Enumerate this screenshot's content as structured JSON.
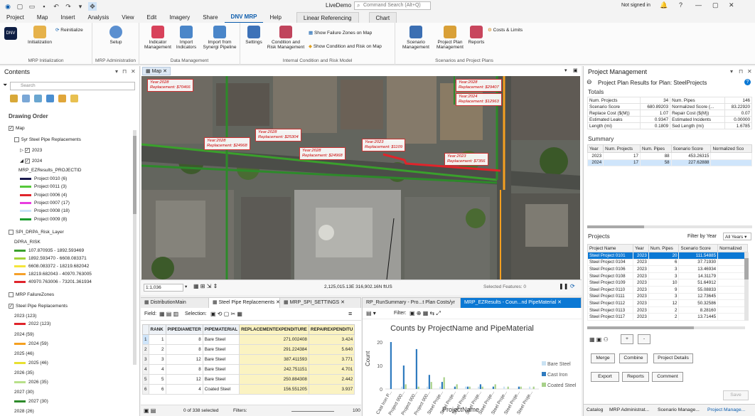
{
  "window": {
    "doc_title": "LiveDemo",
    "search_placeholder": "Command Search (Alt+Q)",
    "signin": "Not signed in"
  },
  "tabs": [
    "Project",
    "Map",
    "Insert",
    "Analysis",
    "View",
    "Edit",
    "Imagery",
    "Share",
    "DNV MRP",
    "Help",
    "Linear Referencing",
    "Chart"
  ],
  "ribbon": {
    "groups": [
      "MRP Initialization",
      "MRP Administration",
      "Data Management",
      "Internal Condition and Risk Model",
      "Scenarios and Project Plans"
    ],
    "buttons": {
      "dnv": "DNV",
      "initialization": "Initialization",
      "reinitialize": "Reinitialize",
      "setup": "Setup",
      "indicator": "Indicator\nManagement",
      "import_ind": "Import\nIndicators",
      "import_syn": "Import from\nSynergi Pipeline",
      "settings": "Settings",
      "condition": "Condition and\nRisk Management",
      "failure_zones": "Show Failure Zones on Map",
      "cond_risk_map": "Show Condition and Risk on Map",
      "scenario": "Scenario\nManagement",
      "projplan": "Project Plan\nManagement",
      "reports": "Reports",
      "costs": "Costs & Limits"
    }
  },
  "contents": {
    "title": "Contents",
    "search_placeholder": "Search",
    "drawing_order": "Drawing Order",
    "items": [
      {
        "text": "Map"
      },
      {
        "text": "5yr Steel Pipe Replacements"
      },
      {
        "text": "2023"
      },
      {
        "text": "2024"
      },
      {
        "text": "MRP_EZResults_PROJECTID"
      },
      {
        "text": "Project 0010 (6)",
        "color": "#1a1a4d"
      },
      {
        "text": "Project 0011 (3)",
        "color": "#56c83a"
      },
      {
        "text": "Project 0006 (4)",
        "color": "#e0242b"
      },
      {
        "text": "Project 0007 (17)",
        "color": "#e83de0"
      },
      {
        "text": "Project 0008 (18)",
        "color": "#c9e3f7"
      },
      {
        "text": "Project 0009 (8)",
        "color": "#1b9c2f"
      },
      {
        "text": "SPI_DRPA_Risk_Layer"
      },
      {
        "text": "DPRA_RISK"
      },
      {
        "text": "107.870935 - 1892.593469",
        "color": "#3aa02c"
      },
      {
        "text": "1892.593470 - 6608.083371",
        "color": "#a4d33a"
      },
      {
        "text": "6608.083372 - 18219.682042",
        "color": "#f5e53a"
      },
      {
        "text": "18219.682043 - 40970.763005",
        "color": "#f5a02a"
      },
      {
        "text": "40970.763006 - 73201.361934",
        "color": "#e0242b"
      },
      {
        "text": "MRP FailureZones"
      },
      {
        "text": "Steel Pipe Replacements"
      },
      {
        "text": "2023 (123)"
      },
      {
        "text": "2022 (123)",
        "color": "#e0242b"
      },
      {
        "text": "2024 (59)"
      },
      {
        "text": "2024 (59)",
        "color": "#f5a020"
      },
      {
        "text": "2025 (46)"
      },
      {
        "text": "2025 (46)",
        "color": "#e8e030"
      },
      {
        "text": "2026 (35)"
      },
      {
        "text": "2026 (35)",
        "color": "#b8e08a"
      },
      {
        "text": "2027 (30)"
      },
      {
        "text": "2027 (30)",
        "color": "#2d8a2a"
      },
      {
        "text": "2028 (26)"
      }
    ]
  },
  "map": {
    "tab": "Map",
    "scale": "1:1,036",
    "coords": "2,125,015.13E 316,902.16N ftUS",
    "selected": "Selected Features: 0",
    "callouts": [
      {
        "year": "Year:2028",
        "repl": "Replacement: $70466"
      },
      {
        "year": "Year:2028",
        "repl": "Replacement: $29407"
      },
      {
        "year": "Year:2024",
        "repl": "Replacement: $12963"
      },
      {
        "year": "Year:2028",
        "repl": "Replacement: $25304"
      },
      {
        "year": "Year:2028",
        "repl": "Replacement: $24968"
      },
      {
        "year": "Year:2028",
        "repl": "Replacement: $24968"
      },
      {
        "year": "Year:2023",
        "repl": "Replacement: $1109"
      },
      {
        "year": "Year:2023",
        "repl": "Replacement: $7356"
      }
    ]
  },
  "table": {
    "tabs": [
      "DistributionMain",
      "Steel Pipe Replacements",
      "MRP_SPI_SETTINGS"
    ],
    "field_label": "Field:",
    "selection_label": "Selection:",
    "columns": [
      "",
      "RANK",
      "PIPEDIAMETER",
      "PIPEMATERIAL",
      "REPLACEMENTEXPENDITURE",
      "REPAIREXPENDITU"
    ],
    "rows": [
      [
        "1",
        "1",
        "8",
        "Bare Steel",
        "271.002408",
        "3.424"
      ],
      [
        "2",
        "2",
        "8",
        "Bare Steel",
        "291.224384",
        "5.640"
      ],
      [
        "3",
        "3",
        "12",
        "Bare Steel",
        "387.411593",
        "3.771"
      ],
      [
        "4",
        "4",
        "8",
        "Bare Steel",
        "242.751151",
        "4.701"
      ],
      [
        "5",
        "5",
        "12",
        "Bare Steel",
        "250.884308",
        "2.442"
      ],
      [
        "6",
        "6",
        "4",
        "Coated Steel",
        "156.551205",
        "3.937"
      ]
    ],
    "footer": "0 of 338 selected",
    "filters": "Filters:",
    "zoom": "100"
  },
  "chart": {
    "tabs": [
      "RP_RunSummary - Pro...t Plan Costs/yr",
      "MRP_EZResults - Coun...nd PipeMaterial"
    ],
    "filter_label": "Filter:",
    "chart_data": {
      "type": "bar",
      "title": "Counts by ProjectName and PipeMaterial",
      "xlabel": "ProjectName",
      "ylabel": "Count",
      "ylim": [
        0,
        20
      ],
      "yticks": [
        "20",
        "10",
        "0"
      ],
      "categories": [
        "Cast Iron P...",
        "Project 000...",
        "Project 000...",
        "Project 000...",
        "Steel Proje...",
        "Steel Proje...",
        "Steel Proje...",
        "Steel Proje...",
        "Steel Proje...",
        "Steel Proje...",
        "Steel Proje...",
        "Steel Proje..."
      ],
      "series": [
        {
          "name": "Bare Steel",
          "color": "#c9e2f3",
          "values": [
            0,
            1,
            0,
            1,
            1,
            0,
            1,
            1,
            0,
            1,
            0,
            1
          ]
        },
        {
          "name": "Cast Iron",
          "color": "#2f7bbf",
          "values": [
            20,
            10,
            17,
            6,
            3,
            1,
            1,
            2,
            1,
            0,
            1,
            0
          ]
        },
        {
          "name": "Coated Steel",
          "color": "#a8d18a",
          "values": [
            0,
            2,
            1,
            3,
            5,
            2,
            1,
            1,
            2,
            1,
            1,
            1
          ]
        }
      ]
    }
  },
  "pm": {
    "title": "Project Management",
    "plan_title": "Project Plan Results for Plan: SteelProjects",
    "totals_title": "Totals",
    "totals": [
      [
        "Num. Projects",
        "34",
        "Num. Pipes",
        "146"
      ],
      [
        "Scenario Score",
        "680.89203",
        "Normalized Score (...",
        "83.22920"
      ],
      [
        "Replace Cost ($(M))",
        "1.07",
        "Repair Cost ($(M))",
        "0.07"
      ],
      [
        "Estimated Leaks",
        "0.9347",
        "Estimated Incidents",
        "0.00000"
      ],
      [
        "Length (mi)",
        "0.1809",
        "Sed Length (mi)",
        "1.6785"
      ]
    ],
    "summary_title": "Summary",
    "summary_cols": [
      "Year",
      "Num. Projects",
      "Num. Pipes",
      "Scenario Score",
      "Normalized Sco"
    ],
    "summary_rows": [
      [
        "2023",
        "17",
        "88",
        "453.26315",
        ""
      ],
      [
        "2024",
        "17",
        "58",
        "227.62888",
        ""
      ]
    ],
    "projects_title": "Projects",
    "filter_year_label": "Filter by Year",
    "filter_year_value": "All Years",
    "proj_cols": [
      "Project Name",
      "Year",
      "Num. Pipes",
      "Scenario Score",
      "Normalized"
    ],
    "proj_rows": [
      [
        "Steel Project 0101",
        "2023",
        "20",
        "111.54885"
      ],
      [
        "Steel Project 0104",
        "2023",
        "6",
        "37.71930"
      ],
      [
        "Steel Project 0106",
        "2023",
        "3",
        "13.46934"
      ],
      [
        "Steel Project 0108",
        "2023",
        "3",
        "14.31179"
      ],
      [
        "Steel Project 0109",
        "2023",
        "10",
        "51.64912"
      ],
      [
        "Steel Project 0110",
        "2023",
        "9",
        "55.08833"
      ],
      [
        "Steel Project 0111",
        "2023",
        "3",
        "12.73645"
      ],
      [
        "Steel Project 0112",
        "2023",
        "12",
        "50.32586"
      ],
      [
        "Steel Project 0113",
        "2023",
        "2",
        "8.28160"
      ],
      [
        "Steel Project 0117",
        "2023",
        "2",
        "13.71445"
      ]
    ],
    "buttons": {
      "add": "+",
      "remove": "-",
      "merge": "Merge",
      "combine": "Combine",
      "details": "Project Details",
      "export": "Export",
      "reports": "Reports",
      "comment": "Comment",
      "save": "Save"
    },
    "bottom_tabs": [
      "Catalog",
      "MRP Administrat...",
      "Scenario Manage...",
      "Project Manage..."
    ]
  }
}
